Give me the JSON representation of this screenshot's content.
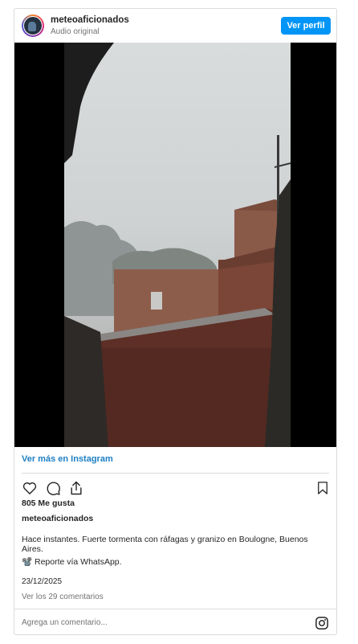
{
  "header": {
    "username": "meteoaficionados",
    "subtitle": "Audio original",
    "view_profile_label": "Ver perfil"
  },
  "link": {
    "view_more": "Ver más en Instagram"
  },
  "post": {
    "likes": "805 Me gusta",
    "owner": "meteoaficionados",
    "caption": "Hace instantes. Fuerte tormenta con ráfagas y granizo en Boulogne, Buenos Aires.",
    "caption_line2": "📽️ Reporte vía WhatsApp.",
    "date": "23/12/2025",
    "view_comments": "Ver los 29 comentarios"
  },
  "comment_box": {
    "placeholder": "Agrega un comentario..."
  },
  "colors": {
    "accent": "#0095f6",
    "link": "#1d7fc4",
    "border": "#dbdbdb"
  },
  "icons": [
    "heart-icon",
    "comment-icon",
    "share-icon",
    "bookmark-icon",
    "instagram-icon"
  ]
}
